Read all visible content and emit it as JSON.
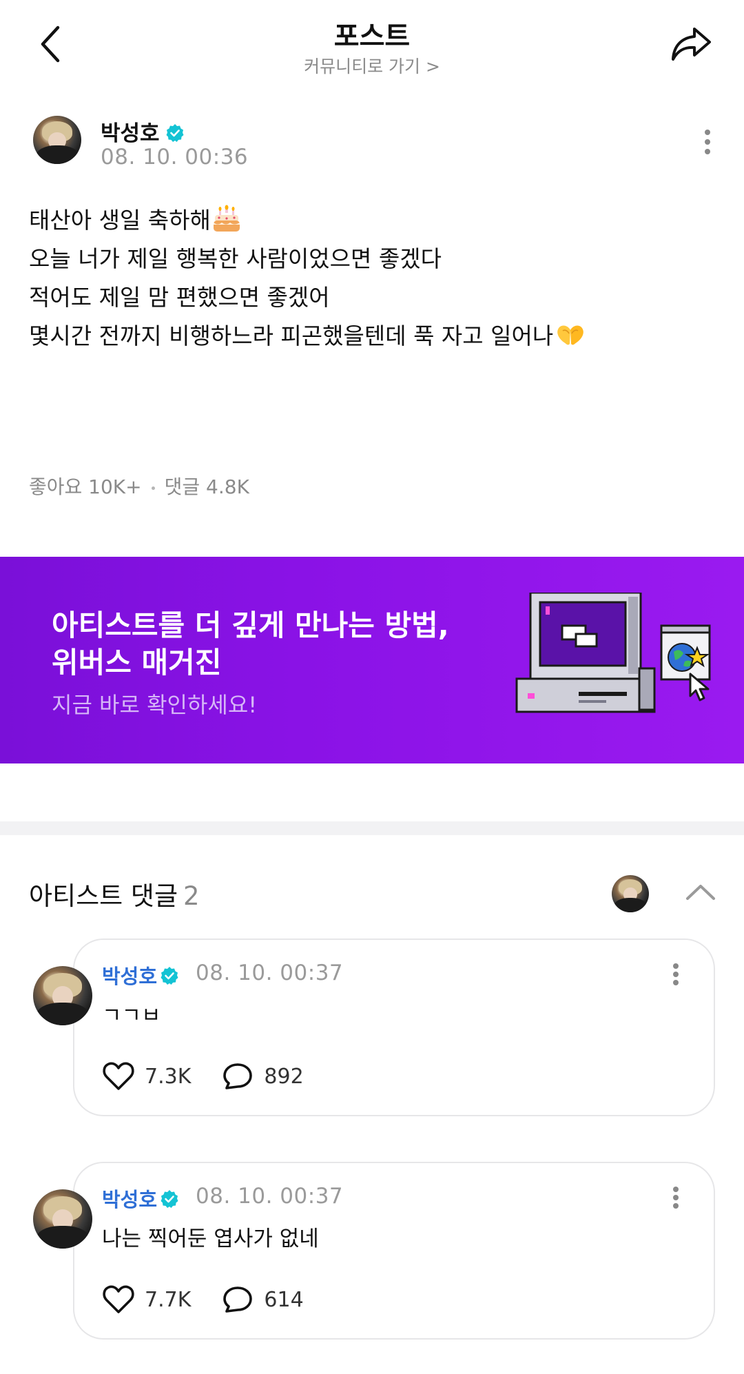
{
  "header": {
    "title": "포스트",
    "subtitle": "커뮤니티로 가기 >"
  },
  "post": {
    "author": "박성호",
    "date": "08. 10. 00:36",
    "lines": [
      "태산아 생일 축하해",
      "오늘 너가 제일 행복한 사람이었으면 좋겠다",
      "적어도 제일 맘 편했으면 좋겠어",
      "몇시간 전까지 비행하느라 피곤했을텐데 푹 자고 일어나"
    ],
    "emojis": [
      "birthday-cake",
      "heart-hands"
    ],
    "likes_label": "좋아요 10K+",
    "comments_label": "댓글 4.8K"
  },
  "banner": {
    "line1": "아티스트를 더 깊게 만나는 방법,",
    "line2": "위버스 매거진",
    "sub": "지금 바로 확인하세요!",
    "colors": {
      "start": "#7a10d8",
      "end": "#9a1af0"
    }
  },
  "artist_comments": {
    "title": "아티스트 댓글",
    "count": "2",
    "items": [
      {
        "author": "박성호",
        "date": "08. 10. 00:37",
        "text": "ㄱㄱㅂ",
        "likes": "7.3K",
        "replies": "892"
      },
      {
        "author": "박성호",
        "date": "08. 10. 00:37",
        "text": "나는 찍어둔 엽사가 없네",
        "likes": "7.7K",
        "replies": "614"
      }
    ]
  },
  "colors": {
    "verified": "#14c3d4",
    "comment_author": "#2f6fd6"
  },
  "icons": [
    "back-arrow-icon",
    "share-icon",
    "verified-icon",
    "more-icon",
    "chevron-up-icon",
    "heart-icon",
    "comment-bubble-icon"
  ]
}
